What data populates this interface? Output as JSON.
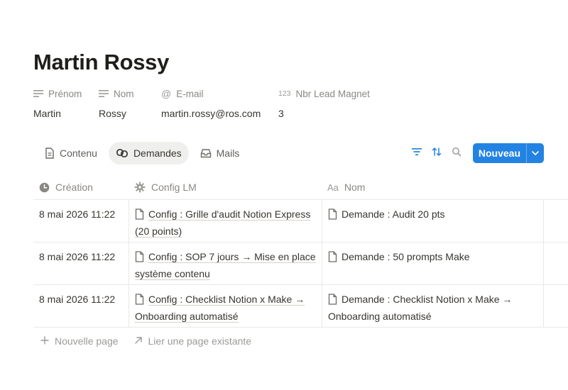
{
  "page": {
    "title": "Martin Rossy"
  },
  "properties": [
    {
      "label": "Prénom",
      "value": "Martin",
      "icon": "text-lines-icon"
    },
    {
      "label": "Nom",
      "value": "Rossy",
      "icon": "text-lines-icon"
    },
    {
      "label": "E-mail",
      "value": "martin.rossy@ros.com",
      "icon": "at-icon"
    },
    {
      "label": "Nbr Lead Magnet",
      "value": "3",
      "icon": "number-icon",
      "icon_text": "123"
    }
  ],
  "tabs": [
    {
      "label": "Contenu",
      "icon": "document-icon",
      "active": false
    },
    {
      "label": "Demandes",
      "icon": "relation-icon",
      "active": true
    },
    {
      "label": "Mails",
      "icon": "inbox-icon",
      "active": false
    }
  ],
  "toolbar": {
    "new_label": "Nouveau",
    "accent": "#2383e2"
  },
  "table": {
    "columns": [
      {
        "label": "Création",
        "icon": "clock-icon"
      },
      {
        "label": "Config LM",
        "icon": "gear-icon"
      },
      {
        "label": "Nom",
        "icon": "title-icon",
        "icon_text": "Aa"
      }
    ],
    "rows": [
      {
        "created": "8 mai 2026 11:22",
        "config": "Config : Grille d'audit Notion Express (20 points)",
        "name": "Demande : Audit 20 pts"
      },
      {
        "created": "8 mai 2026 11:22",
        "config": "Config : SOP 7 jours → Mise en place système contenu",
        "name": "Demande : 50 prompts Make"
      },
      {
        "created": "8 mai 2026 11:22",
        "config": "Config : Checklist Notion x Make → Onboarding automatisé",
        "name": "Demande : Checklist Notion x Make → Onboarding automatisé"
      }
    ],
    "footer": {
      "new_page": "Nouvelle page",
      "link_existing": "Lier une page existante"
    }
  }
}
